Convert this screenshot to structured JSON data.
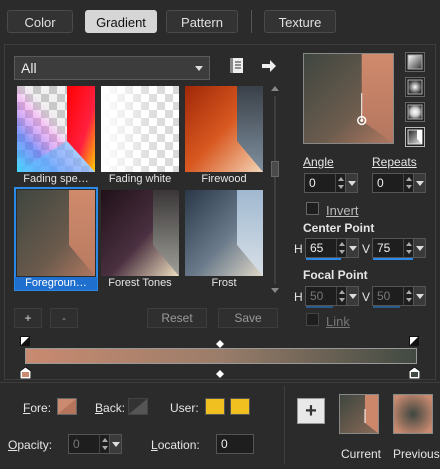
{
  "tabs": [
    {
      "label": "Color",
      "active": false
    },
    {
      "label": "Gradient",
      "active": true
    },
    {
      "label": "Pattern",
      "active": false
    },
    {
      "label": "Texture",
      "active": false
    }
  ],
  "category": {
    "selected": "All"
  },
  "icons": {
    "library": "library-icon",
    "forward": "arrow-right-icon"
  },
  "presets": [
    {
      "label": "Fading spe…",
      "selected": false
    },
    {
      "label": "Fading white",
      "selected": false
    },
    {
      "label": "Firewood",
      "selected": false
    },
    {
      "label": "Foregroun…",
      "selected": true
    },
    {
      "label": "Forest Tones",
      "selected": false
    },
    {
      "label": "Frost",
      "selected": false
    }
  ],
  "preset_buttons": {
    "add": "+",
    "remove": "-",
    "reset": "Reset",
    "save": "Save"
  },
  "angle": {
    "label": "Angle",
    "value": "0"
  },
  "repeats": {
    "label": "Repeats",
    "value": "0"
  },
  "invert": {
    "label": "Invert",
    "checked": false
  },
  "center_point": {
    "label": "Center Point",
    "h_label": "H",
    "h": "65",
    "v_label": "V",
    "v": "75"
  },
  "focal_point": {
    "label": "Focal Point",
    "h_label": "H",
    "h": "50",
    "v_label": "V",
    "v": "50"
  },
  "link": {
    "label": "Link",
    "checked": false
  },
  "footer": {
    "fore_label": "Fore:",
    "back_label": "Back:",
    "user_label": "User:",
    "opacity_label": "Opacity:",
    "opacity_value": "0",
    "location_label": "Location:",
    "location_value": "0",
    "add_label": "+",
    "current_label": "Current",
    "previous_label": "Previous"
  },
  "colors": {
    "accent": "#2a8ae6",
    "gradient_start": "#c98a70",
    "gradient_end": "#414a42",
    "user_swatch": "#f0c020"
  }
}
